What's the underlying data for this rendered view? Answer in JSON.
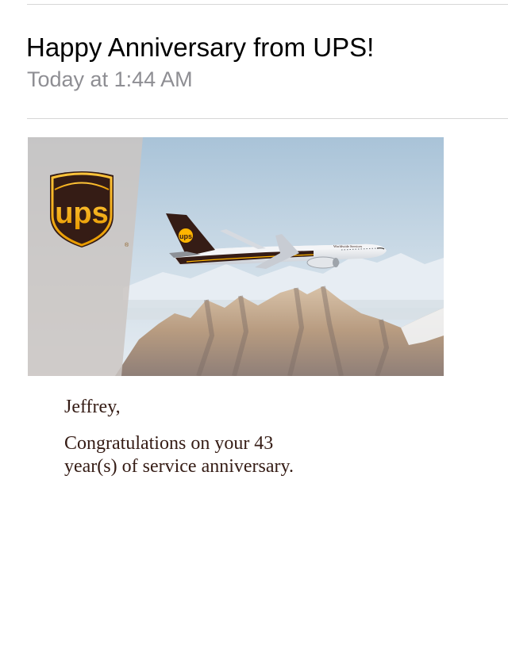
{
  "email": {
    "subject": "Happy Anniversary from UPS!",
    "timestamp": "Today at 1:44 AM"
  },
  "banner": {
    "logo_text": "ups",
    "aircraft_tail_text": "ups",
    "aircraft_fuselage_text": "Worldwide Services",
    "colors": {
      "brand_brown": "#351c15",
      "brand_gold": "#ffb500",
      "sky": "#b9cfe0",
      "side_panel": "#cbc6c2"
    }
  },
  "message": {
    "salutation": "Jeffrey,",
    "line1": "Congratulations on your 43",
    "line2": "year(s) of service anniversary."
  }
}
